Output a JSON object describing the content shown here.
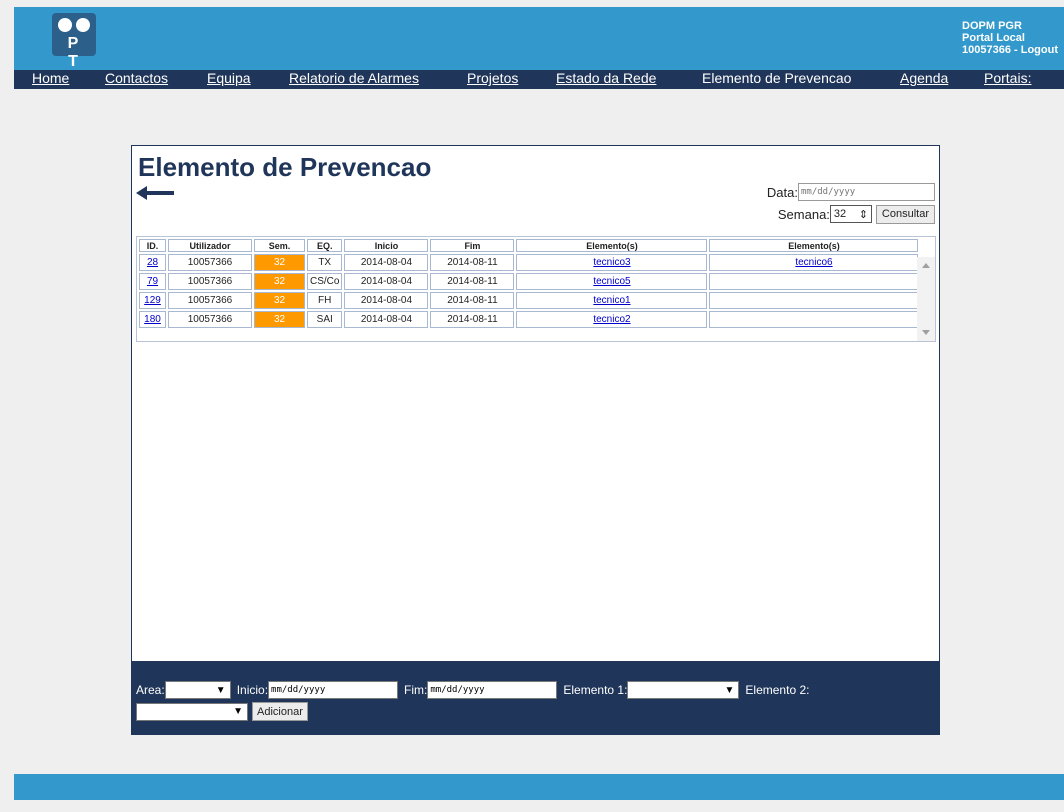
{
  "header": {
    "logo_letters": "P T",
    "user_line1": "DOPM PGR",
    "user_line2": "Portal Local",
    "user_line3": "10057366 - Logout"
  },
  "nav": {
    "items": [
      {
        "label": "Home",
        "link": true
      },
      {
        "label": "Contactos",
        "link": true
      },
      {
        "label": "Equipa",
        "link": true
      },
      {
        "label": "Relatorio de Alarmes",
        "link": true
      },
      {
        "label": "Projetos",
        "link": true
      },
      {
        "label": "Estado da Rede",
        "link": true
      },
      {
        "label": "Elemento de Prevencao",
        "link": false
      },
      {
        "label": "Agenda",
        "link": true
      },
      {
        "label": "Portais:",
        "link": true
      }
    ]
  },
  "main": {
    "title": "Elemento de Prevencao",
    "query": {
      "data_label": "Data:",
      "data_placeholder": "mm/dd/yyyy",
      "semana_label": "Semana:",
      "semana_value": "32",
      "consultar_label": "Consultar"
    },
    "table": {
      "headers": [
        "ID.",
        "Utilizador",
        "Sem.",
        "EQ.",
        "Inicio",
        "Fim",
        "Elemento(s)",
        "Elemento(s)"
      ],
      "rows": [
        {
          "id": "28",
          "user": "10057366",
          "sem": "32",
          "eq": "TX",
          "inicio": "2014-08-04",
          "fim": "2014-08-11",
          "el1": "tecnico3",
          "el2": "tecnico6"
        },
        {
          "id": "79",
          "user": "10057366",
          "sem": "32",
          "eq": "CS/Co",
          "inicio": "2014-08-04",
          "fim": "2014-08-11",
          "el1": "tecnico5",
          "el2": ""
        },
        {
          "id": "129",
          "user": "10057366",
          "sem": "32",
          "eq": "FH",
          "inicio": "2014-08-04",
          "fim": "2014-08-11",
          "el1": "tecnico1",
          "el2": ""
        },
        {
          "id": "180",
          "user": "10057366",
          "sem": "32",
          "eq": "SAI",
          "inicio": "2014-08-04",
          "fim": "2014-08-11",
          "el1": "tecnico2",
          "el2": ""
        }
      ]
    }
  },
  "form": {
    "area_label": "Area:",
    "inicio_label": "Inicio:",
    "inicio_placeholder": "mm/dd/yyyy",
    "fim_label": "Fim:",
    "fim_placeholder": "mm/dd/yyyy",
    "elemento1_label": "Elemento 1:",
    "elemento2_label": "Elemento 2:",
    "adicionar_label": "Adicionar"
  },
  "colors": {
    "header_blue": "#3399cc",
    "nav_navy": "#1f3559",
    "sem_orange": "#ff9900"
  }
}
